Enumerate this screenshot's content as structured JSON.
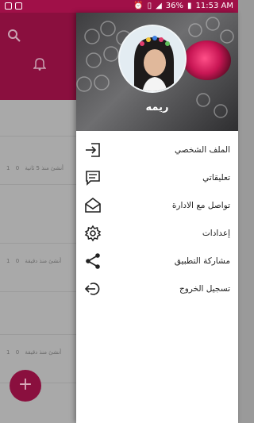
{
  "status_bar": {
    "battery": "36%",
    "time": "11:53 AM"
  },
  "background_cards": [
    {
      "time": "أنشئ منذ 5 ثانية",
      "views": "0",
      "likes": "1"
    },
    {
      "time": "أنشئ منذ دقيقة",
      "views": "0",
      "likes": "1"
    },
    {
      "time": "أنشئ منذ دقيقة",
      "views": "0",
      "likes": "1"
    }
  ],
  "drawer": {
    "user_name": "ريمه",
    "menu": [
      {
        "label": "الملف الشخصي",
        "icon": "login-icon"
      },
      {
        "label": "تعليقاتي",
        "icon": "comment-icon"
      },
      {
        "label": "تواصل مع الادارة",
        "icon": "mail-icon"
      },
      {
        "label": "إعدادات",
        "icon": "gear-icon"
      },
      {
        "label": "مشاركة التطبيق",
        "icon": "share-icon"
      },
      {
        "label": "تسجيل الخروج",
        "icon": "logout-icon"
      }
    ]
  },
  "fab": {
    "label": "+"
  },
  "colors": {
    "primary": "#a01048",
    "primary_dim": "#8a0f3e",
    "drawer_bg": "#ffffff"
  }
}
